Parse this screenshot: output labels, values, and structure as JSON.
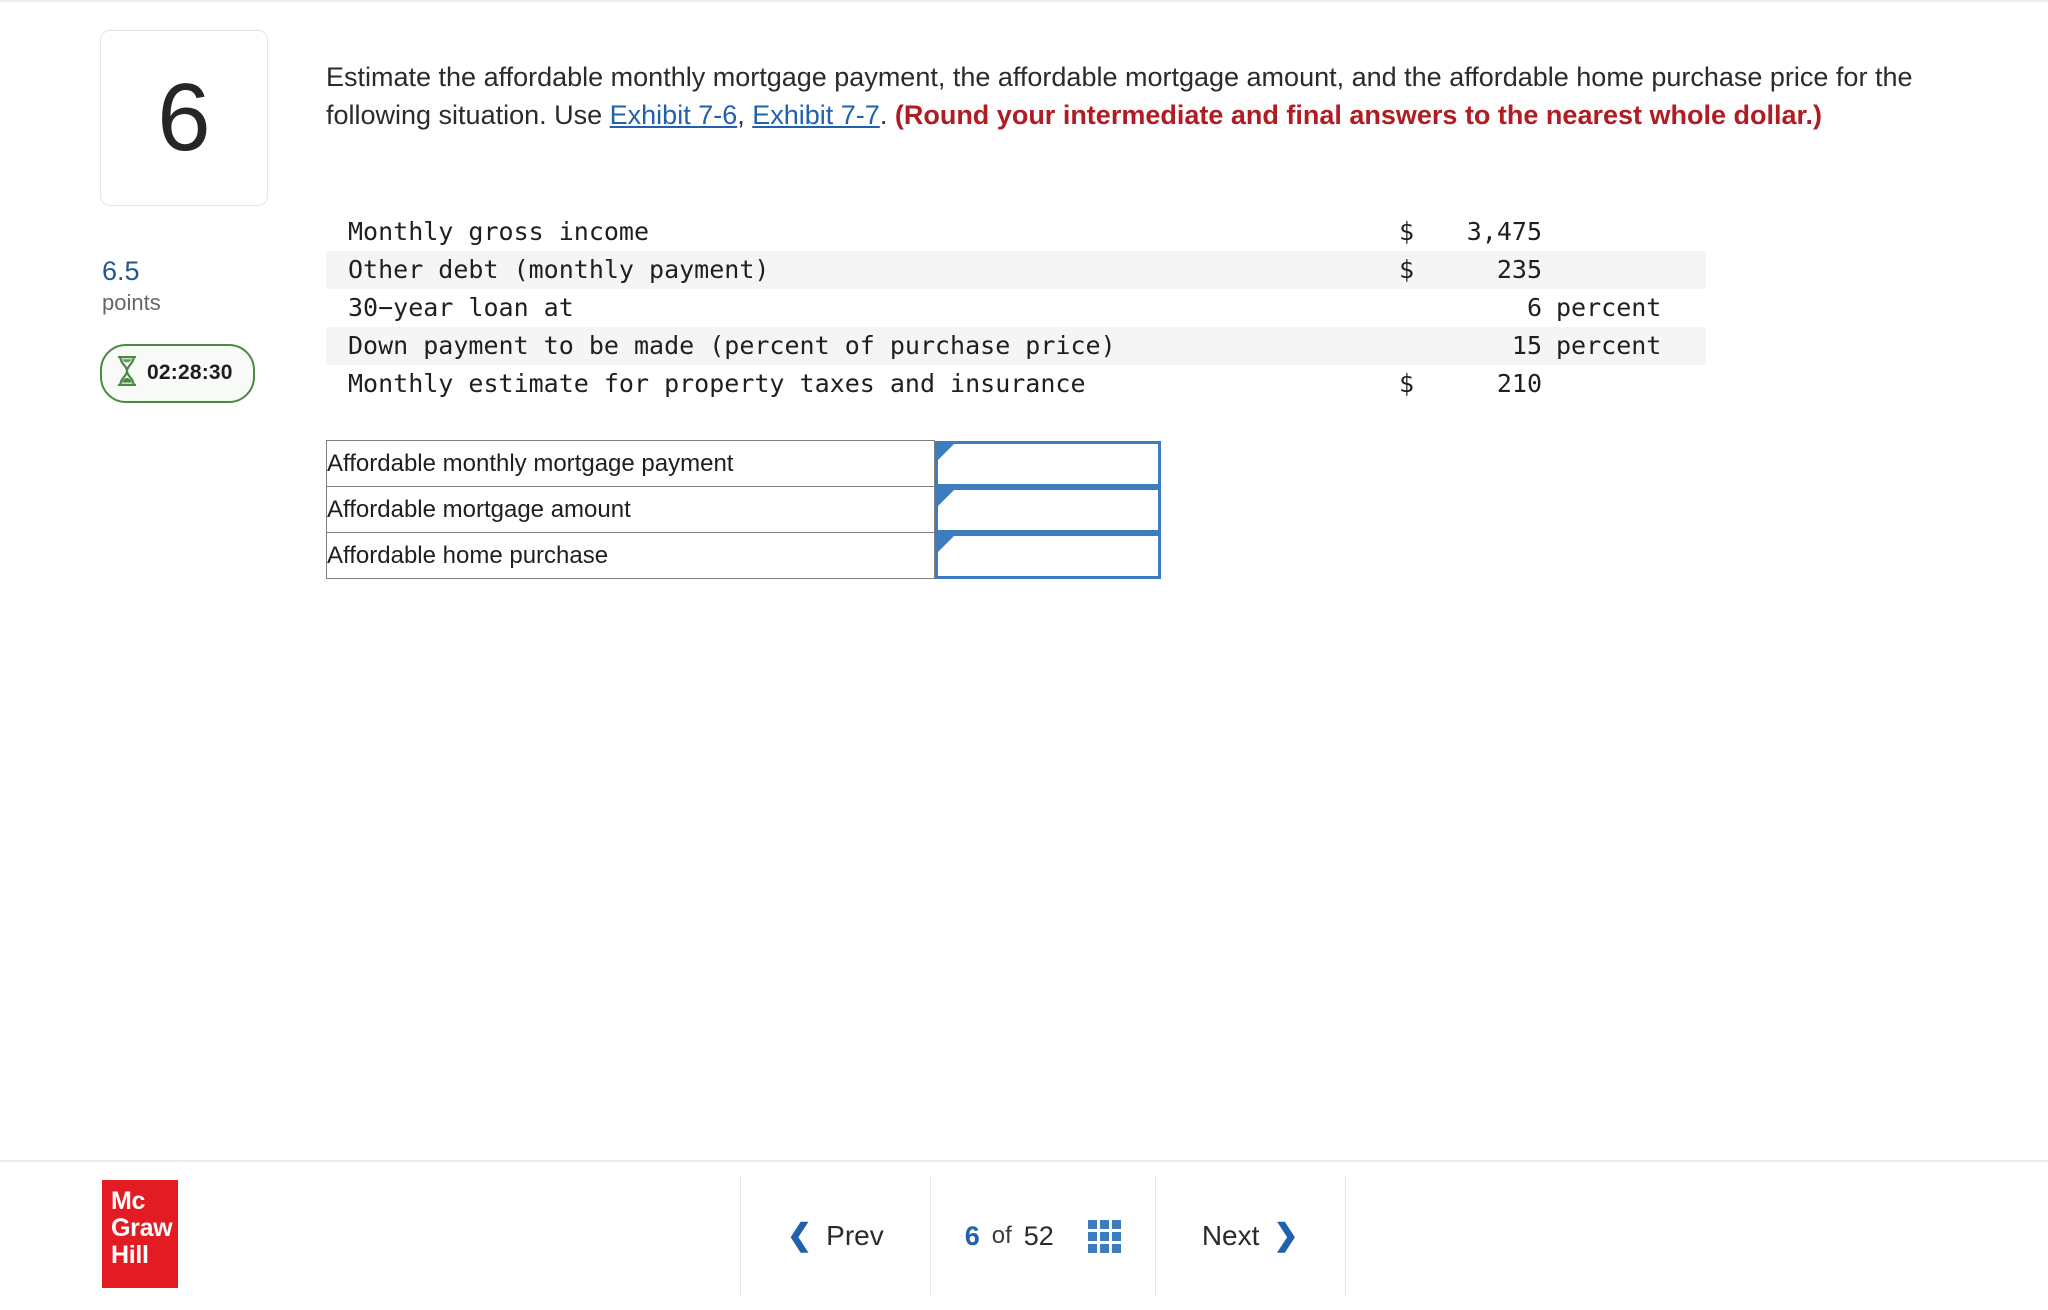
{
  "question": {
    "number": "6",
    "points_value": "6.5",
    "points_label": "points",
    "timer": "02:28:30",
    "timer_icon": "hourglass-icon",
    "stem_part1": "Estimate the affordable monthly mortgage payment, the affordable mortgage amount, and the affordable home purchase price for the following situation. Use ",
    "link1": "Exhibit 7-6",
    "stem_sep": ", ",
    "link2": "Exhibit 7-7",
    "stem_part2": ". ",
    "round_note": "(Round your intermediate and final answers to the nearest whole dollar.)"
  },
  "facts": {
    "rows": [
      {
        "label": "Monthly gross income",
        "currency": "$",
        "number": "3,475",
        "unit": ""
      },
      {
        "label": "Other debt (monthly payment)",
        "currency": "$",
        "number": "235",
        "unit": ""
      },
      {
        "label": "30−year loan at",
        "currency": "",
        "number": "6",
        "unit": "percent"
      },
      {
        "label": "Down payment to be made (percent of purchase price)",
        "currency": "",
        "number": "15",
        "unit": "percent"
      },
      {
        "label": "Monthly estimate for property taxes and insurance",
        "currency": "$",
        "number": "210",
        "unit": ""
      }
    ]
  },
  "answers": {
    "rows": [
      {
        "label": "Affordable monthly mortgage payment",
        "value": "",
        "placeholder": ""
      },
      {
        "label": "Affordable mortgage amount",
        "value": "",
        "placeholder": ""
      },
      {
        "label": "Affordable home purchase",
        "value": "",
        "placeholder": ""
      }
    ]
  },
  "footer": {
    "logo_line1": "Mc",
    "logo_line2": "Graw",
    "logo_line3": "Hill",
    "prev_label": "Prev",
    "prev_icon": "chevron-left-icon",
    "current_page": "6",
    "of_label": "of",
    "total_pages": "52",
    "grid_icon": "grid-menu-icon",
    "next_label": "Next",
    "next_icon": "chevron-right-icon"
  },
  "colors": {
    "link_blue": "#1f61ad",
    "note_red": "#b01c23",
    "input_border_blue": "#3d7cc0",
    "timer_green": "#4a8a43",
    "logo_red": "#e31b23",
    "points_blue": "#235789"
  }
}
